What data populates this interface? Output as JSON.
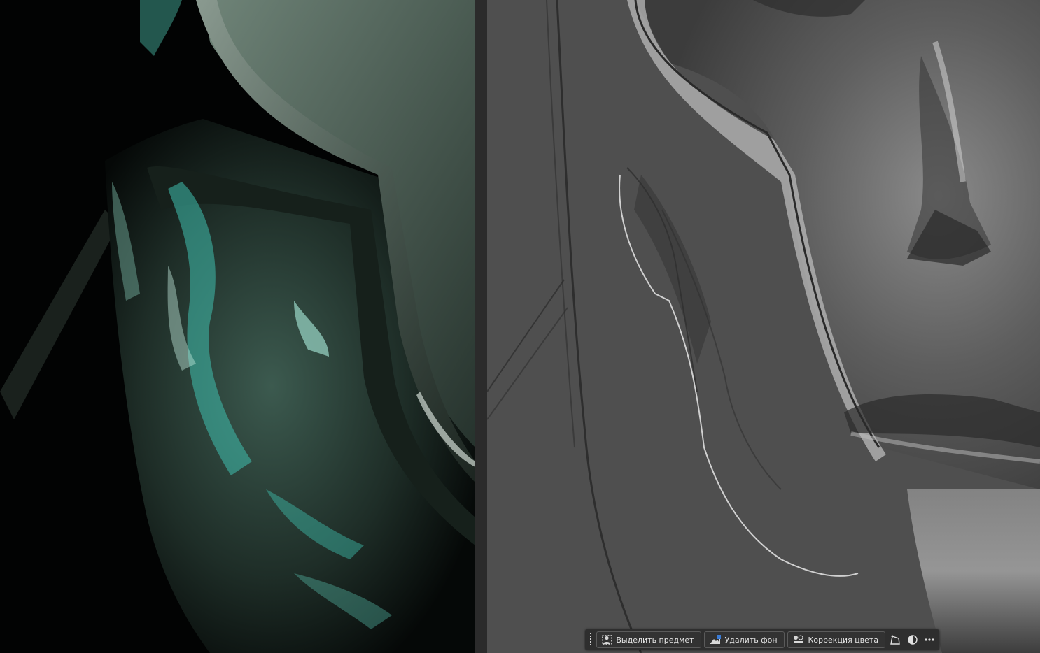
{
  "taskbar": {
    "select_subject": "Выделить предмет",
    "remove_background": "Удалить фон",
    "color_correction": "Коррекция цвета",
    "icons": [
      "drag-handle-icon",
      "person-select-icon",
      "image-remove-bg-icon",
      "color-adjust-icon",
      "transform-icon",
      "mask-contrast-icon",
      "more-options-icon"
    ]
  },
  "colors": {
    "reference_bg": "#020303",
    "patina": "#3fbfae",
    "canvas_bg": "#4f4f4f",
    "divider": "#2b2b2b",
    "taskbar_bg": "#2e2e2e"
  }
}
